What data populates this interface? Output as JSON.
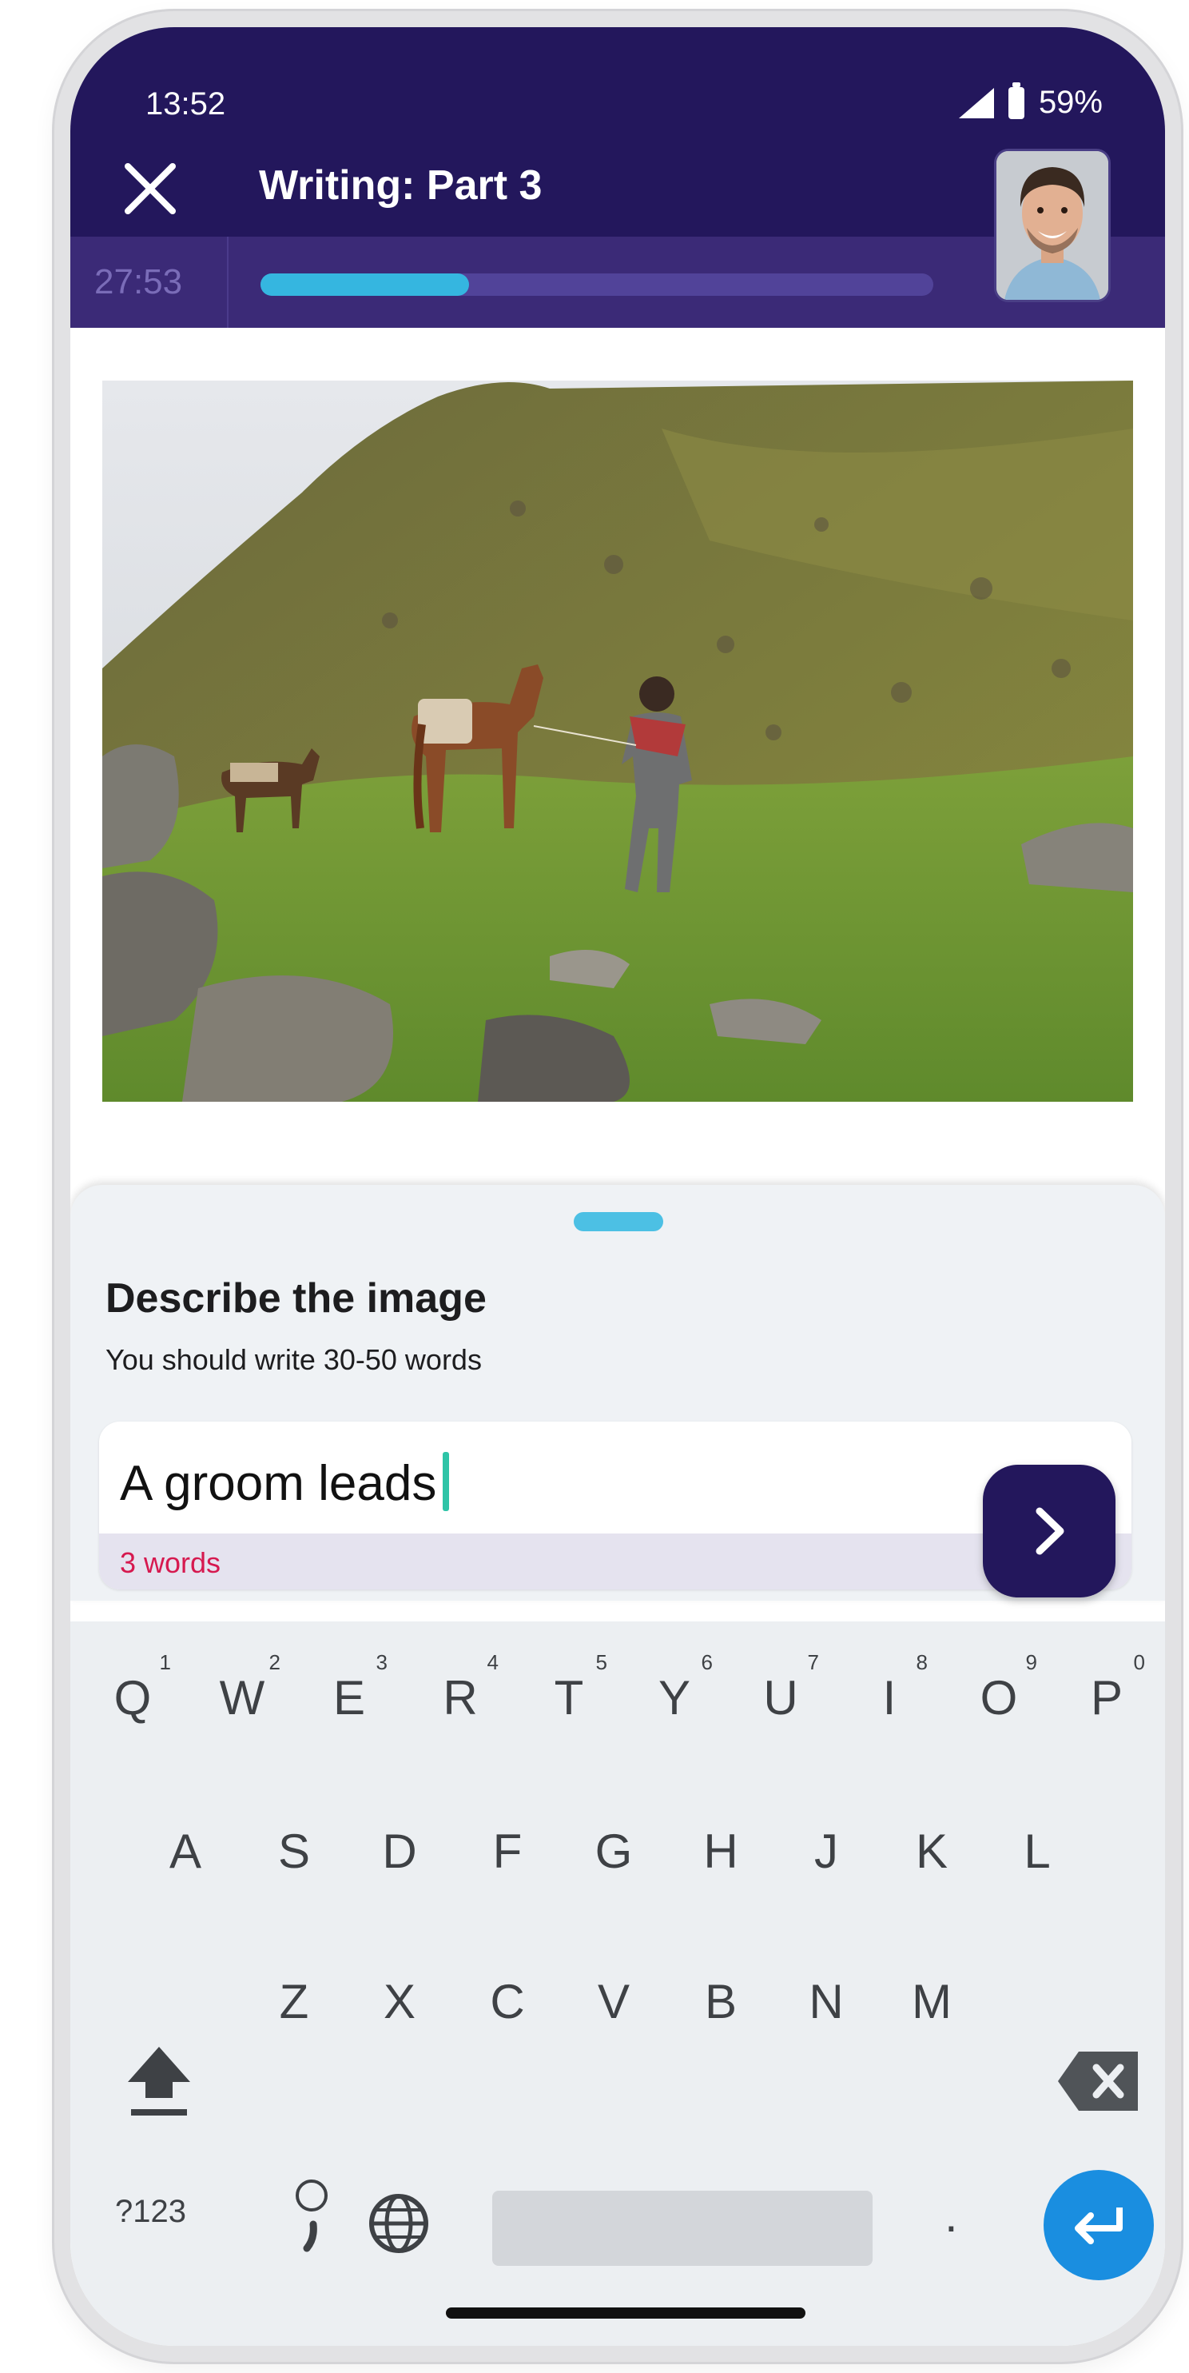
{
  "status_bar": {
    "time": "13:52",
    "battery": "59%"
  },
  "header": {
    "title": "Writing: Part 3",
    "close_icon": "close-icon"
  },
  "timer": {
    "remaining": "27:53",
    "progress_fraction": 0.31
  },
  "avatar": {
    "icon": "examiner-avatar"
  },
  "image": {
    "icon": "landscape-photo"
  },
  "prompt": {
    "title": "Describe the image",
    "instruction": "You should write 30-50 words"
  },
  "answer": {
    "text": "A groom leads",
    "word_count": "3 words"
  },
  "submit": {
    "icon": "chevron-right-icon"
  },
  "keyboard": {
    "row1": [
      {
        "key": "Q",
        "hint": "1"
      },
      {
        "key": "W",
        "hint": "2"
      },
      {
        "key": "E",
        "hint": "3"
      },
      {
        "key": "R",
        "hint": "4"
      },
      {
        "key": "T",
        "hint": "5"
      },
      {
        "key": "Y",
        "hint": "6"
      },
      {
        "key": "U",
        "hint": "7"
      },
      {
        "key": "I",
        "hint": "8"
      },
      {
        "key": "O",
        "hint": "9"
      },
      {
        "key": "P",
        "hint": "0"
      }
    ],
    "row2": [
      "A",
      "S",
      "D",
      "F",
      "G",
      "H",
      "J",
      "K",
      "L"
    ],
    "row3": [
      "Z",
      "X",
      "C",
      "V",
      "B",
      "N",
      "M"
    ],
    "symbols_label": "?123",
    "period_label": ".",
    "colors": {
      "enter": "#1a8ee0",
      "header": "#23175c",
      "accent": "#35b6e0",
      "word_count": "#d6194f"
    }
  }
}
